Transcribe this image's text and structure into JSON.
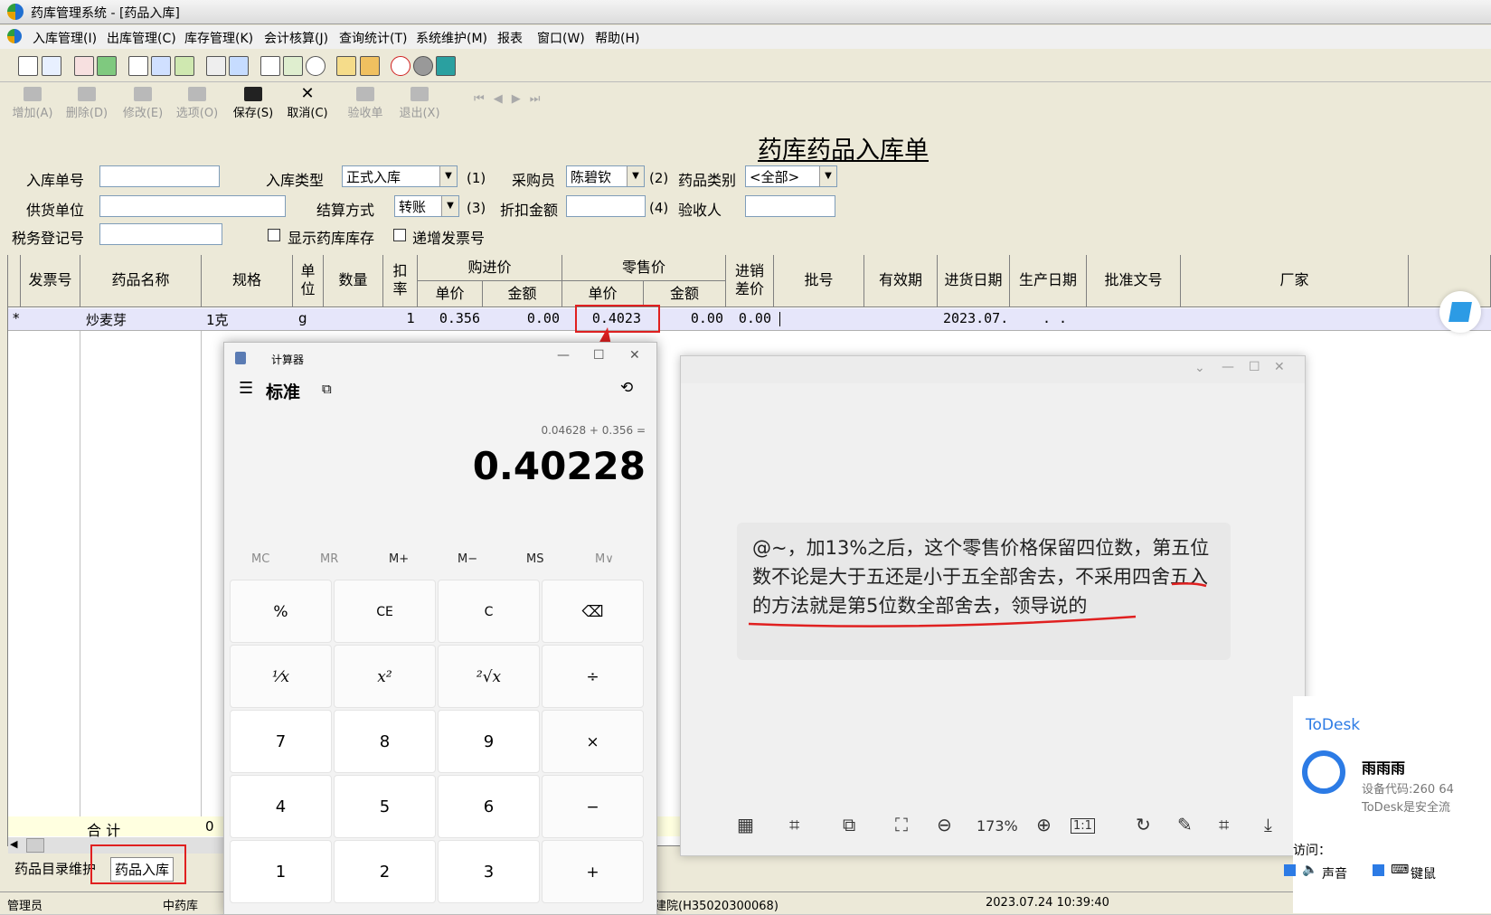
{
  "window": {
    "title": "药库管理系统 - [药品入库]"
  },
  "menu": [
    "入库管理(I)",
    "出库管理(C)",
    "库存管理(K)",
    "会计核算(J)",
    "查询统计(T)",
    "系统维护(M)",
    "报表",
    "窗口(W)",
    "帮助(H)"
  ],
  "toolbar2": [
    {
      "label": "增加(A)",
      "enabled": false
    },
    {
      "label": "删除(D)",
      "enabled": false
    },
    {
      "label": "修改(E)",
      "enabled": false
    },
    {
      "label": "选项(O)",
      "enabled": false
    },
    {
      "label": "保存(S)",
      "enabled": true
    },
    {
      "label": "取消(C)",
      "enabled": true
    },
    {
      "label": "验收单",
      "enabled": false
    },
    {
      "label": "退出(X)",
      "enabled": false
    }
  ],
  "form": {
    "title": "药库药品入库单",
    "entry_no_label": "入库单号",
    "entry_type_label": "入库类型",
    "entry_type_value": "正式入库",
    "entry_type_hint": "(1)",
    "buyer_label": "采购员",
    "buyer_value": "陈碧钦",
    "buyer_hint": "(2)",
    "drug_class_label": "药品类别",
    "drug_class_value": "<全部>",
    "supplier_label": "供货单位",
    "settle_label": "结算方式",
    "settle_value": "转账",
    "settle_hint": "(3)",
    "discount_label": "折扣金额",
    "discount_hint": "(4)",
    "inspector_label": "验收人",
    "tax_label": "税务登记号",
    "show_stock_label": "显示药库库存",
    "invoice_inc_label": "递增发票号"
  },
  "grid": {
    "headers": {
      "invoice": "发票号",
      "name": "药品名称",
      "spec": "规格",
      "unit": "单位",
      "qty": "数量",
      "discount": "扣率",
      "purchase": "购进价",
      "p_unit": "单价",
      "p_amount": "金额",
      "retail": "零售价",
      "r_unit": "单价",
      "r_amount": "金额",
      "diff": "进销差价",
      "batch": "批号",
      "expiry": "有效期",
      "in_date": "进货日期",
      "mfg_date": "生产日期",
      "approval": "批准文号",
      "maker": "厂家"
    },
    "row": {
      "marker": "*",
      "name": "炒麦芽",
      "spec": "1克",
      "unit": "g",
      "discount": "1",
      "p_unit": "0.356",
      "p_amount": "0.00",
      "r_unit": "0.4023",
      "r_amount": "0.00",
      "diff": "0.00",
      "in_date": "2023.07.",
      "mfg_date": ".  ."
    },
    "total_label": "合  计",
    "total_value": "0"
  },
  "tabs": [
    "药品目录维护",
    "药品入库"
  ],
  "status": {
    "user": "管理员",
    "dept": "中药库",
    "org": "建院(H35020300068)",
    "datetime": "2023.07.24 10:39:40"
  },
  "calculator": {
    "app_name": "计算器",
    "mode": "标准",
    "expression": "0.04628 + 0.356 =",
    "display": "0.40228",
    "memory": [
      "MC",
      "MR",
      "M+",
      "M−",
      "MS",
      "M∨"
    ],
    "keys": [
      "%",
      "CE",
      "C",
      "⌫",
      "¹⁄x",
      "x²",
      "²√x",
      "÷",
      "7",
      "8",
      "9",
      "×",
      "4",
      "5",
      "6",
      "−",
      "1",
      "2",
      "3",
      "+"
    ]
  },
  "viewer": {
    "message": "@~，加13%之后，这个零售价格保留四位数，第五位数不论是大于五还是小于五全部舍去，不采用四舍五入的方法就是第5位数全部舍去，领导说的",
    "zoom": "173%",
    "actual_size": "1:1"
  },
  "todesk": {
    "brand": "ToDesk",
    "user": "雨雨雨",
    "device_code": "设备代码:260 64",
    "safe_note": "ToDesk是安全流",
    "visit_label": "访问：",
    "sound_label": "声音",
    "keyboard_label": "键鼠"
  }
}
